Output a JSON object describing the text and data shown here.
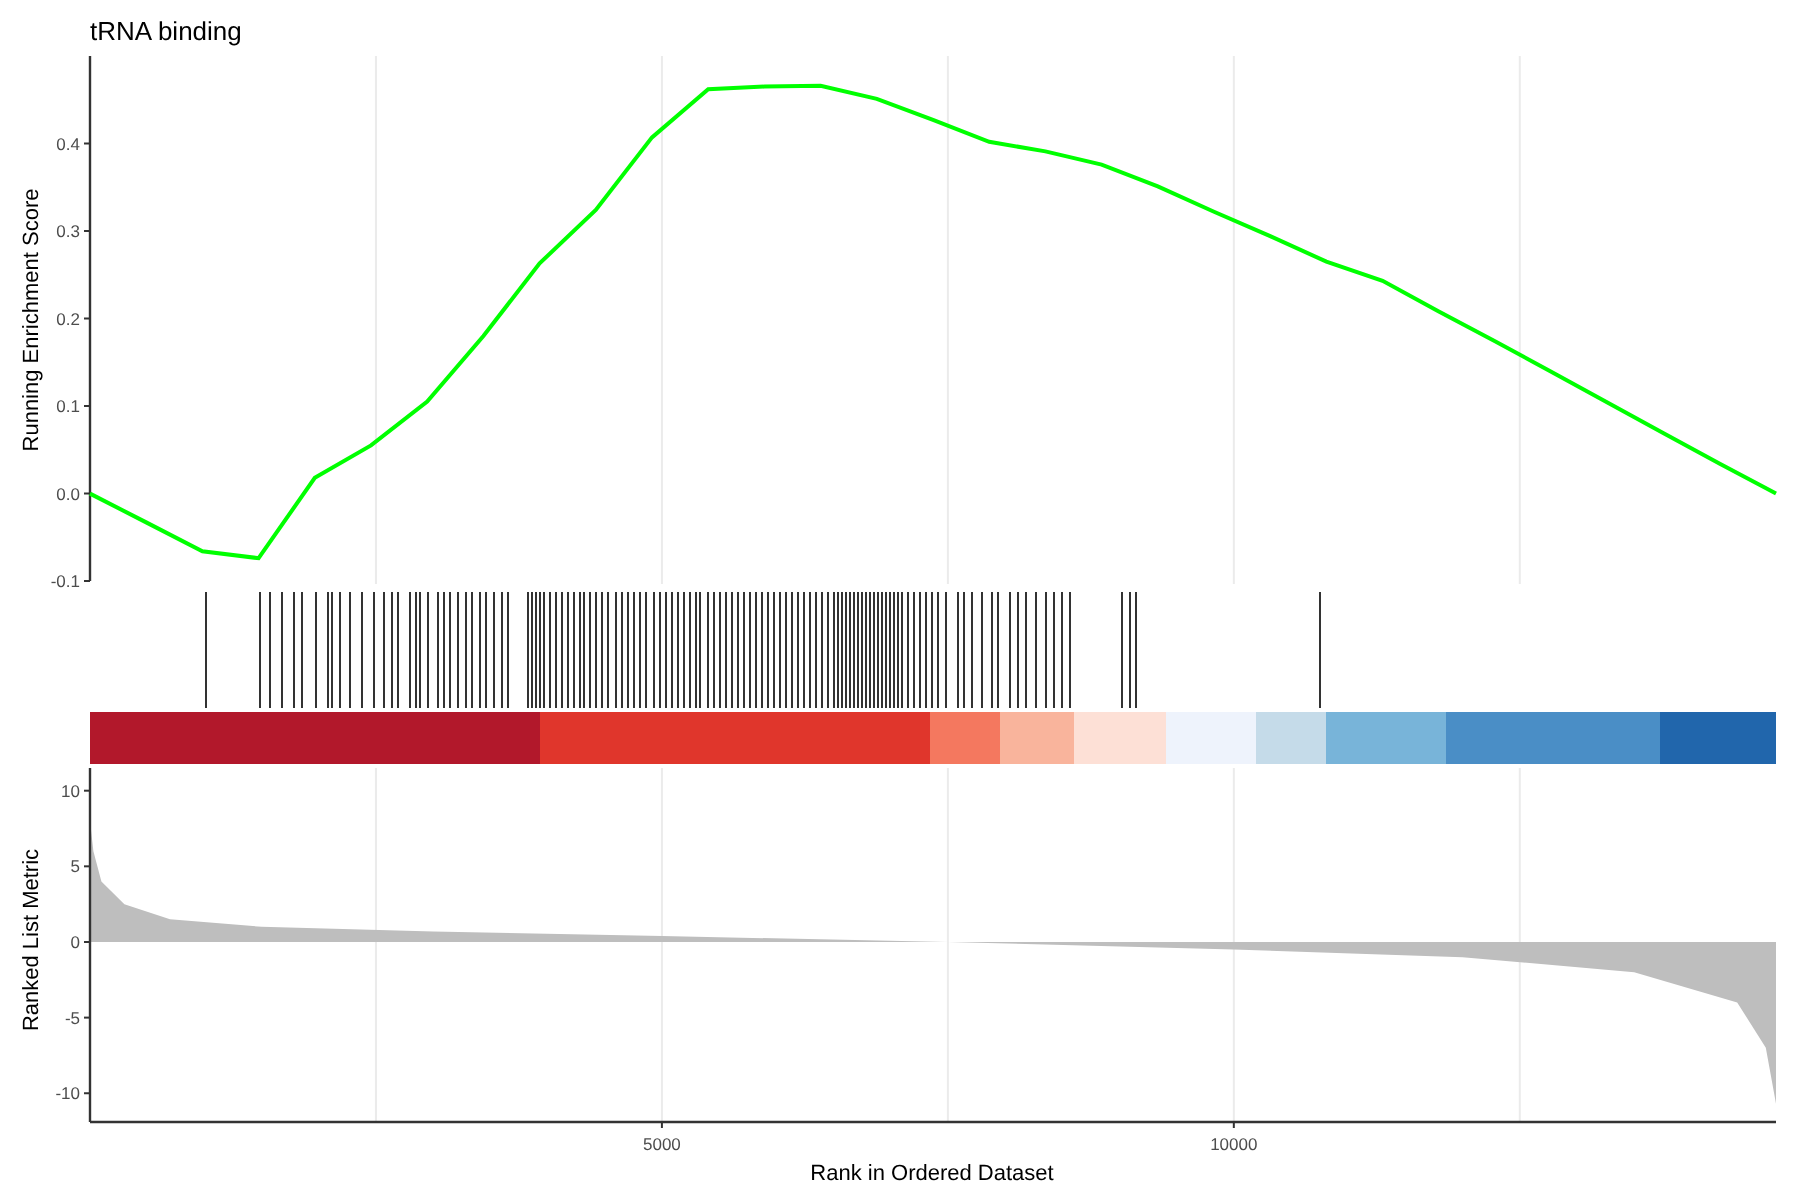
{
  "title": "tRNA binding",
  "enrichment_plot": {
    "chart_data": {
      "type": "line",
      "ylabel": "Running Enrichment Score",
      "ylim": [
        -0.1,
        0.5
      ],
      "yticks": [
        {
          "value": -0.1,
          "label": "-0.1"
        },
        {
          "value": 0,
          "label": "0.0"
        },
        {
          "value": 0.1,
          "label": "0.1"
        },
        {
          "value": 0.2,
          "label": "0.2"
        },
        {
          "value": 0.3,
          "label": "0.3"
        },
        {
          "value": 0.4,
          "label": "0.4"
        }
      ],
      "series": [
        {
          "color": "#00ff00",
          "values": [
            0,
            -0.033,
            -0.066,
            -0.074,
            0.018,
            0.055,
            0.105,
            0.18,
            0.263,
            0.324,
            0.407,
            0.462,
            0.465,
            0.466,
            0.451,
            0.427,
            0.402,
            0.391,
            0.376,
            0.351,
            0.322,
            0.294,
            0.265,
            0.243,
            0.208,
            0.174,
            0.139,
            0.104,
            0.069,
            0.034,
            0
          ]
        }
      ]
    }
  },
  "ranked_plot": {
    "chart_data": {
      "type": "area",
      "xlabel": "Rank in Ordered Dataset",
      "ylabel": "Ranked List Metric",
      "xlim": [
        0,
        14740
      ],
      "ylim": [
        -11.9,
        11.5
      ],
      "xticks": [
        5000,
        10000
      ],
      "yticks": [
        -10,
        -5,
        0,
        5,
        10
      ],
      "x": [
        0,
        30,
        100,
        300,
        700,
        1500,
        3000,
        5000,
        7500,
        10000,
        12000,
        13500,
        14400,
        14650,
        14740
      ],
      "series": [
        {
          "color": "#bebebe",
          "values": [
            8,
            6,
            4,
            2.5,
            1.5,
            1,
            0.7,
            0.4,
            0,
            -0.5,
            -1,
            -2,
            -4,
            -7,
            -10.7
          ]
        }
      ]
    }
  }
}
